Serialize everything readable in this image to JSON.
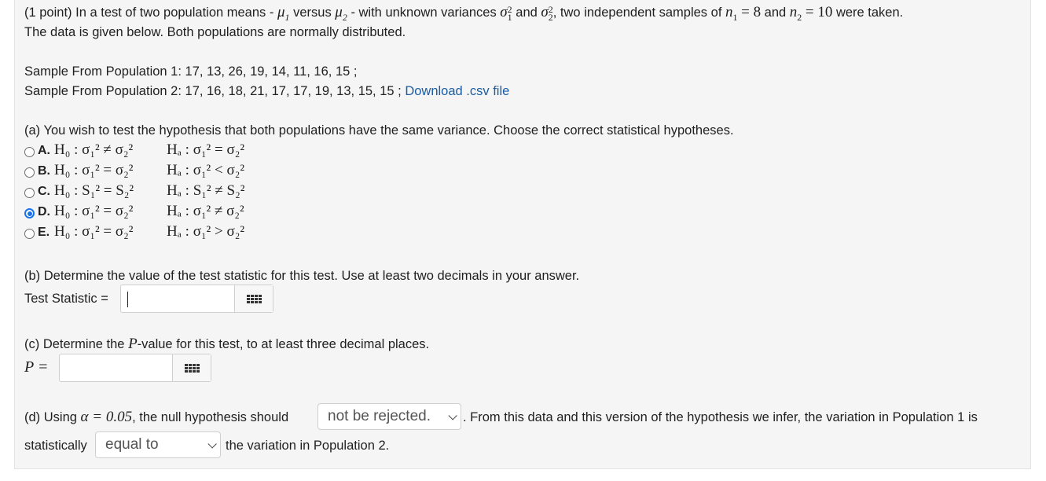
{
  "intro": {
    "points": "(1 point)",
    "part1": "In a test of two population means -",
    "mu1": "μ",
    "versus": "versus",
    "mu2": "μ",
    "part2": "- with unknown variances",
    "sigma": "σ",
    "and": "and",
    "part3": ", two independent samples of",
    "n1_val": "8",
    "n2_val": "10",
    "part4": "were taken.",
    "line2": "The data is given below. Both populations are normally distributed."
  },
  "samples": {
    "pop1": "Sample From Population 1: 17, 13, 26, 19, 14, 11, 16, 15 ;",
    "pop2": "Sample From Population 2: 17, 16, 18, 21, 17, 17, 19, 13, 15, 15 ;",
    "download_link": "Download .csv file"
  },
  "part_a": {
    "question": "(a) You wish to test the hypothesis that both populations have the same variance. Choose the correct statistical hypotheses.",
    "options": [
      {
        "letter": "A.",
        "h0": "H₀ : σ₁² ≠ σ₂²",
        "ha": "Hₐ : σ₁² = σ₂²",
        "selected": false
      },
      {
        "letter": "B.",
        "h0": "H₀ : σ₁² = σ₂²",
        "ha": "Hₐ : σ₁² < σ₂²",
        "selected": false
      },
      {
        "letter": "C.",
        "h0": "H₀ : S₁² = S₂²",
        "ha": "Hₐ : S₁² ≠ S₂²",
        "selected": false
      },
      {
        "letter": "D.",
        "h0": "H₀ : σ₁² = σ₂²",
        "ha": "Hₐ : σ₁² ≠ σ₂²",
        "selected": true
      },
      {
        "letter": "E.",
        "h0": "H₀ : σ₁² = σ₂²",
        "ha": "Hₐ : σ₁² > σ₂²",
        "selected": false
      }
    ]
  },
  "part_b": {
    "question": "(b) Determine the value of the test statistic for this test. Use at least two decimals in your answer.",
    "label": "Test Statistic =",
    "value": ""
  },
  "part_c": {
    "question_pre": "(c) Determine the",
    "question_p": "P",
    "question_post": "-value for this test, to at least three decimal places.",
    "label": "P =",
    "value": ""
  },
  "part_d": {
    "pre": "(d) Using",
    "alpha": "α = 0.05",
    "mid": ", the null hypothesis should",
    "select1": "not be rejected.",
    "post": ". From this data and this version of the hypothesis we infer, the variation in Population 1 is",
    "line2_pre": "statistically",
    "select2": "equal to",
    "line2_post": "the variation in Population 2."
  },
  "colors": {
    "link": "#1b5da1",
    "radio_selected": "#1a73e8",
    "panel_bg": "#f5f5f5"
  }
}
